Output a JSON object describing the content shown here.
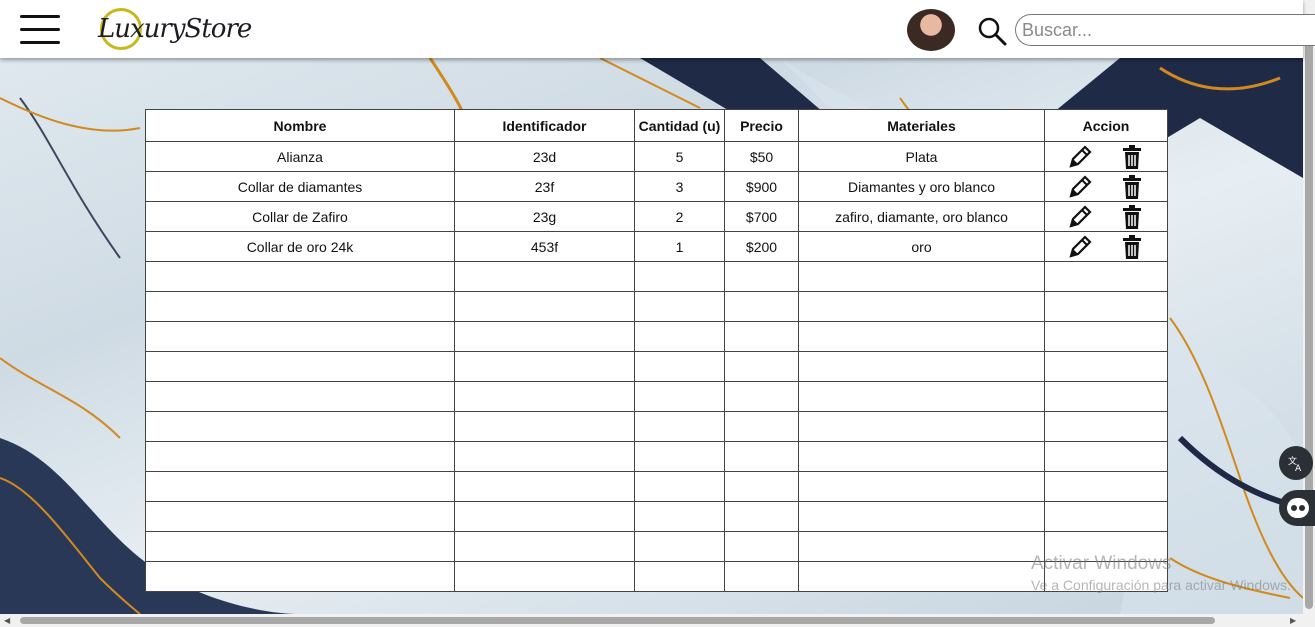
{
  "header": {
    "menu_icon": "hamburger-menu-icon",
    "logo_text": "LuxuryStore",
    "avatar": "user-avatar",
    "search_icon": "search-icon",
    "search_placeholder": "Buscar..."
  },
  "table": {
    "columns": [
      "Nombre",
      "Identificador",
      "Cantidad (u)",
      "Precio",
      "Materiales",
      "Accion"
    ],
    "rows": [
      {
        "nombre": "Alianza",
        "identificador": "23d",
        "cantidad": "5",
        "precio": "$50",
        "materiales": "Plata"
      },
      {
        "nombre": "Collar de diamantes",
        "identificador": "23f",
        "cantidad": "3",
        "precio": "$900",
        "materiales": "Diamantes y oro blanco"
      },
      {
        "nombre": "Collar de Zafiro",
        "identificador": "23g",
        "cantidad": "2",
        "precio": "$700",
        "materiales": "zafiro, diamante, oro blanco"
      },
      {
        "nombre": "Collar de oro 24k",
        "identificador": "453f",
        "cantidad": "1",
        "precio": "$200",
        "materiales": "oro"
      }
    ],
    "empty_rows": 11,
    "action_icons": [
      "pencil-edit-icon",
      "trash-delete-icon"
    ]
  },
  "widgets": {
    "translate_icon": "translate-icon",
    "assistant_icon": "assistant-bot-icon"
  },
  "watermark": {
    "line1": "Activar Windows",
    "line2": "Ve a Configuración para activar Windows."
  },
  "colors": {
    "logo_ring": "#c8b81e",
    "marble_gold": "#d08a1e",
    "marble_navy": "#1e2a44"
  }
}
